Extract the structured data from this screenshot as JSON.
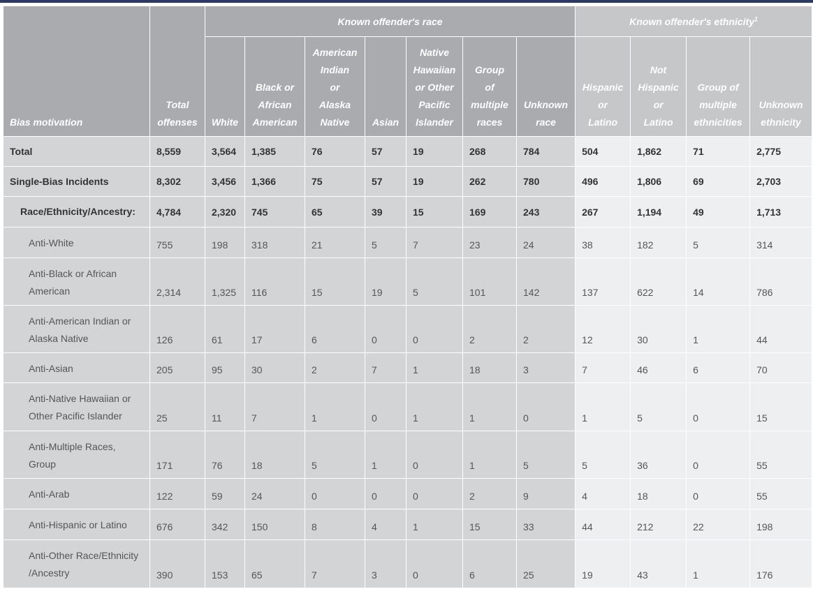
{
  "table": {
    "header": {
      "group_race": "Known offender's race",
      "group_ethnicity": "Known offender's ethnicity",
      "group_ethnicity_sup": "1",
      "columns": [
        [
          "Bias motivation"
        ],
        [
          "Total",
          "offenses"
        ],
        [
          "White"
        ],
        [
          "Black or",
          "African",
          "American"
        ],
        [
          "American",
          "Indian",
          "or",
          "Alaska",
          "Native"
        ],
        [
          "Asian"
        ],
        [
          "Native",
          "Hawaiian",
          "or Other",
          "Pacific",
          "Islander"
        ],
        [
          "Group",
          "of",
          "multiple",
          "races"
        ],
        [
          "Unknown",
          "race"
        ],
        [
          "Hispanic",
          "or",
          "Latino"
        ],
        [
          "Not",
          "Hispanic",
          "or",
          "Latino"
        ],
        [
          "Group of",
          "multiple",
          "ethnicities"
        ],
        [
          "Unknown",
          "ethnicity"
        ]
      ]
    },
    "rows": [
      {
        "label": [
          "Total"
        ],
        "level": 0,
        "bold": true,
        "values": [
          "8,559",
          "3,564",
          "1,385",
          "76",
          "57",
          "19",
          "268",
          "784",
          "504",
          "1,862",
          "71",
          "2,775"
        ]
      },
      {
        "label": [
          "Single-Bias Incidents"
        ],
        "level": 0,
        "bold": true,
        "values": [
          "8,302",
          "3,456",
          "1,366",
          "75",
          "57",
          "19",
          "262",
          "780",
          "496",
          "1,806",
          "69",
          "2,703"
        ]
      },
      {
        "label": [
          "Race/Ethnicity/Ancestry:"
        ],
        "level": 1,
        "bold": true,
        "values": [
          "4,784",
          "2,320",
          "745",
          "65",
          "39",
          "15",
          "169",
          "243",
          "267",
          "1,194",
          "49",
          "1,713"
        ]
      },
      {
        "label": [
          "Anti-White"
        ],
        "level": 2,
        "bold": false,
        "values": [
          "755",
          "198",
          "318",
          "21",
          "5",
          "7",
          "23",
          "24",
          "38",
          "182",
          "5",
          "314"
        ]
      },
      {
        "label": [
          "Anti-Black or African",
          "American"
        ],
        "level": 2,
        "bold": false,
        "values": [
          "2,314",
          "1,325",
          "116",
          "15",
          "19",
          "5",
          "101",
          "142",
          "137",
          "622",
          "14",
          "786"
        ]
      },
      {
        "label": [
          "Anti-American Indian or",
          "Alaska Native"
        ],
        "level": 2,
        "bold": false,
        "values": [
          "126",
          "61",
          "17",
          "6",
          "0",
          "0",
          "2",
          "2",
          "12",
          "30",
          "1",
          "44"
        ]
      },
      {
        "label": [
          "Anti-Asian"
        ],
        "level": 2,
        "bold": false,
        "values": [
          "205",
          "95",
          "30",
          "2",
          "7",
          "1",
          "18",
          "3",
          "7",
          "46",
          "6",
          "70"
        ]
      },
      {
        "label": [
          "Anti-Native Hawaiian or",
          "Other Pacific Islander"
        ],
        "level": 2,
        "bold": false,
        "values": [
          "25",
          "11",
          "7",
          "1",
          "0",
          "1",
          "1",
          "0",
          "1",
          "5",
          "0",
          "15"
        ]
      },
      {
        "label": [
          "Anti-Multiple Races,",
          "Group"
        ],
        "level": 2,
        "bold": false,
        "values": [
          "171",
          "76",
          "18",
          "5",
          "1",
          "0",
          "1",
          "5",
          "5",
          "36",
          "0",
          "55"
        ]
      },
      {
        "label": [
          "Anti-Arab"
        ],
        "level": 2,
        "bold": false,
        "values": [
          "122",
          "59",
          "24",
          "0",
          "0",
          "0",
          "2",
          "9",
          "4",
          "18",
          "0",
          "55"
        ]
      },
      {
        "label": [
          "Anti-Hispanic or Latino"
        ],
        "level": 2,
        "bold": false,
        "values": [
          "676",
          "342",
          "150",
          "8",
          "4",
          "1",
          "15",
          "33",
          "44",
          "212",
          "22",
          "198"
        ]
      },
      {
        "label": [
          "Anti-Other Race/Ethnicity",
          "/Ancestry"
        ],
        "level": 2,
        "bold": false,
        "values": [
          "390",
          "153",
          "65",
          "7",
          "3",
          "0",
          "6",
          "25",
          "19",
          "43",
          "1",
          "176"
        ]
      }
    ]
  }
}
